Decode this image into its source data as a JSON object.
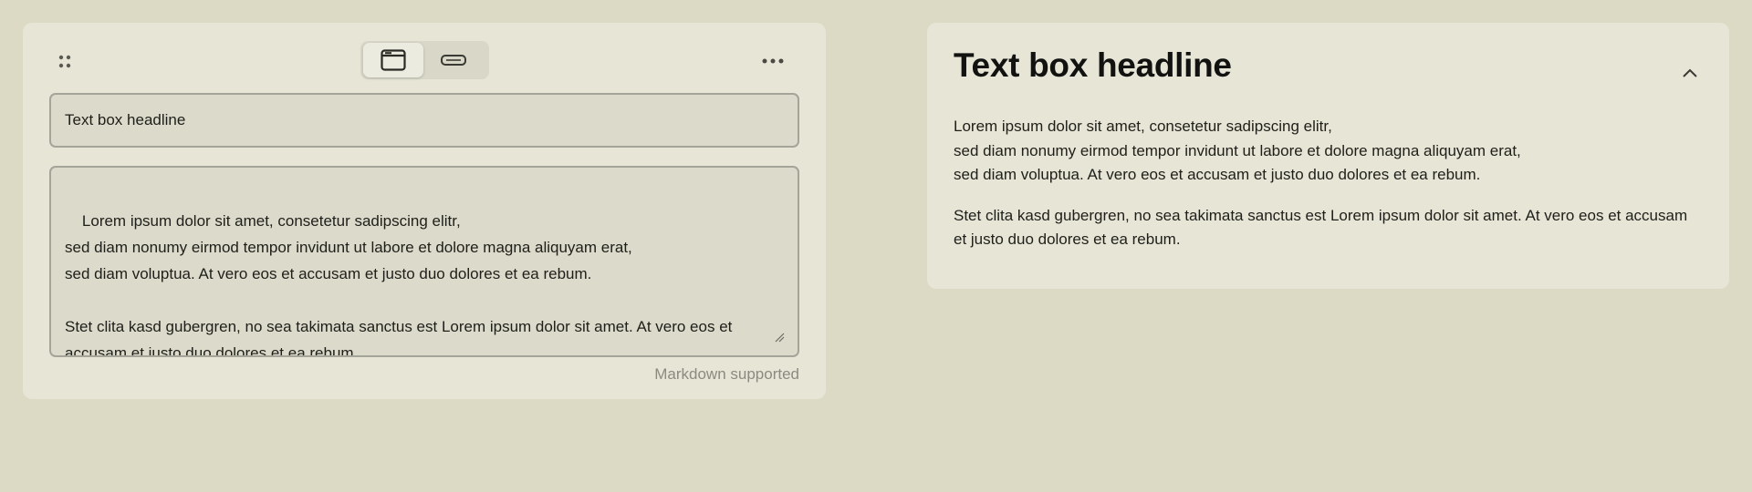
{
  "editor": {
    "headline_value": "Text box headline",
    "body_value": "Lorem ipsum dolor sit amet, consetetur sadipscing elitr,\nsed diam nonumy eirmod tempor invidunt ut labore et dolore magna aliquyam erat,\nsed diam voluptua. At vero eos et accusam et justo duo dolores et ea rebum.\n\nStet clita kasd gubergren, no sea takimata sanctus est Lorem ipsum dolor sit amet. At vero eos et accusam et justo duo dolores et ea rebum.",
    "markdown_hint": "Markdown supported",
    "view_toggle": {
      "options": [
        "card-view-icon",
        "inline-view-icon"
      ],
      "selected": "card-view-icon"
    },
    "icons": {
      "drag": "drag-handle-icon",
      "more": "more-options-icon",
      "resize": "resize-grip-icon"
    }
  },
  "preview": {
    "title": "Text box headline",
    "paragraphs": [
      "Lorem ipsum dolor sit amet, consetetur sadipscing elitr,\nsed diam nonumy eirmod tempor invidunt ut labore et dolore magna aliquyam erat,\nsed diam voluptua. At vero eos et accusam et justo duo dolores et ea rebum.",
      "Stet clita kasd gubergren, no sea takimata sanctus est Lorem ipsum dolor sit amet. At vero eos et accusam et justo duo dolores et ea rebum."
    ],
    "collapse_icon": "chevron-up-icon"
  },
  "colors": {
    "page_background": "#dcdac5",
    "card_background": "#e6e5d6",
    "input_background": "#dbdacb",
    "input_border": "#a5a498",
    "hint_text": "#8a8a80"
  }
}
